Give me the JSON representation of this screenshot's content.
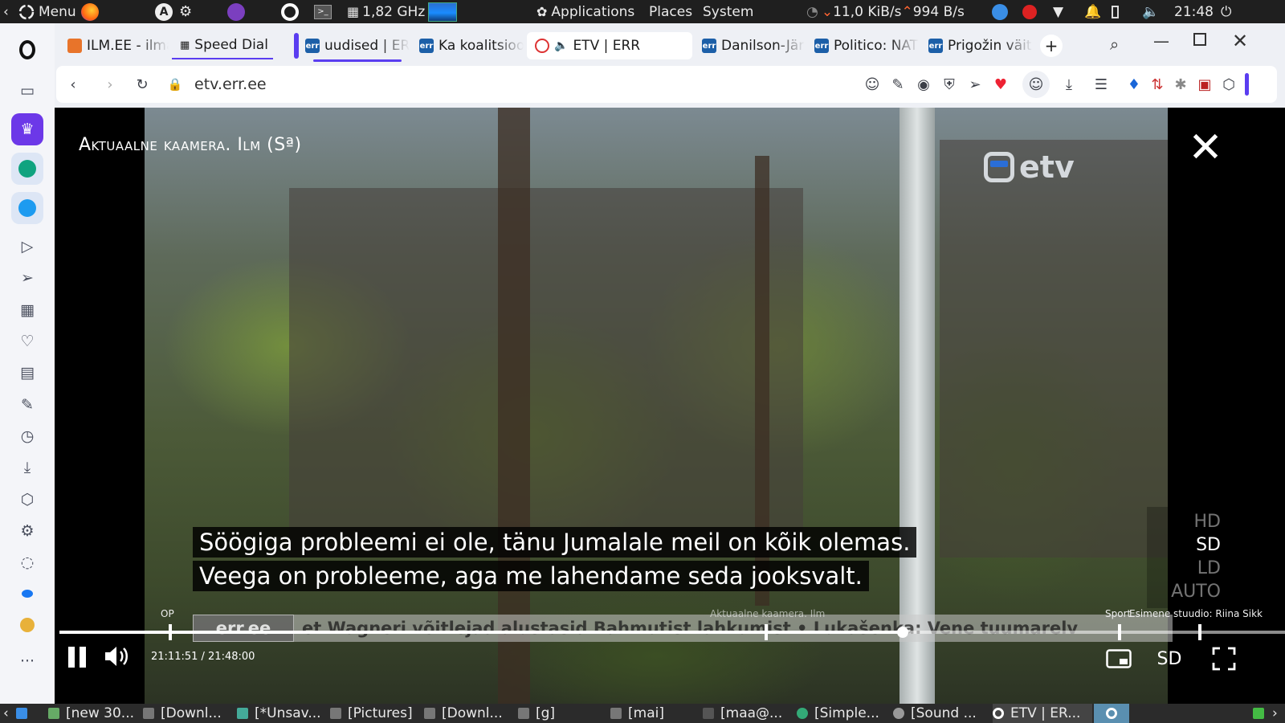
{
  "system_panel": {
    "menu_label": "Menu",
    "cpu_freq": "1,82 GHz",
    "applications": "Applications",
    "places": "Places",
    "system": "System",
    "net_down": "11,0 KiB/s",
    "net_up": "994 B/s",
    "clock": "21:48"
  },
  "tabs": [
    {
      "title": "ILM.EE - ilma",
      "icon": "ilm-favicon"
    },
    {
      "title": "Speed Dial",
      "icon": "speed-dial-icon"
    },
    {
      "title": "uudised | ERR",
      "icon": "err-favicon"
    },
    {
      "title": "Ka koalitsioon",
      "icon": "err-favicon"
    },
    {
      "title": "ETV | ERR",
      "icon": "err-favicon"
    },
    {
      "title": "Danilson-Järg",
      "icon": "err-favicon"
    },
    {
      "title": "Politico: NATO",
      "icon": "err-favicon"
    },
    {
      "title": "Prigožin väitis",
      "icon": "err-favicon"
    }
  ],
  "address": {
    "url": "etv.err.ee"
  },
  "player": {
    "title": "Aktuaalne kaamera. Ilm (Sª)",
    "logo_text": "etv",
    "subtitles": [
      "Söögiga probleemi ei ole, tänu Jumalale meil on kõik olemas.",
      "Veega on probleeme, aga me lahendame seda jooksvalt."
    ],
    "quality_options": [
      "HD",
      "SD",
      "LD",
      "AUTO"
    ],
    "quality_selected": "SD",
    "ticker_source": "err.ee",
    "ticker_text": "et Wagneri võitlejad alustasid Bahmutist lahkumist   •   Lukašenka: Vene tuumarelv",
    "chapters": {
      "left": "OP",
      "middle": "Aktuaalne kaamera. Ilm",
      "right": "Sport",
      "far_right": "Esimene stuudio: Riina Sikk"
    },
    "timecode": "21:11:51 / 21:48:00",
    "progress_fraction": 0.688,
    "quality_button": "SD"
  },
  "taskbar": [
    "[new 30...",
    "[Downl...",
    "[*Unsav...",
    "[Pictures]",
    "[Downl...",
    "[g]",
    "[mai]",
    "[maa@...",
    "[Simple...",
    "[Sound ...",
    "ETV | ER..."
  ]
}
